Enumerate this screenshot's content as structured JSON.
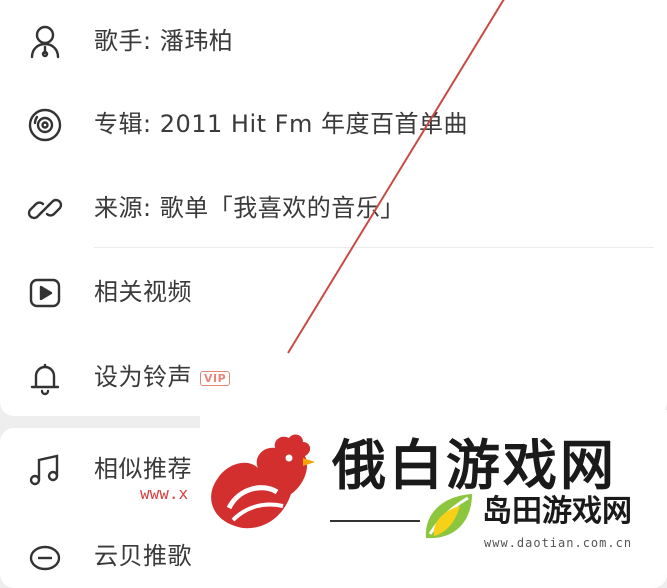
{
  "menu": {
    "items": [
      {
        "label": "歌手: 潘玮柏",
        "icon": "singer-icon"
      },
      {
        "label": "专辑: 2011 Hit Fm 年度百首单曲",
        "icon": "album-disc-icon"
      },
      {
        "label": "来源: 歌单「我喜欢的音乐」",
        "icon": "link-icon"
      },
      {
        "label": "相关视频",
        "icon": "video-play-icon"
      },
      {
        "label": "设为铃声",
        "icon": "bell-icon",
        "badge": "VIP"
      }
    ],
    "more_items": [
      {
        "label": "相似推荐",
        "icon": "music-notes-icon"
      },
      {
        "label": "云贝推歌",
        "icon": "cloud-shell-icon"
      }
    ]
  },
  "watermark": {
    "brand": "俄白游戏网",
    "brand_secondary": "岛田游戏网",
    "url": "www.daotian.com.cn",
    "url_partial": "www.x"
  },
  "colors": {
    "background": "#eeeeee",
    "card": "#ffffff",
    "text": "#3a3a3a",
    "vip": "#e8857a",
    "strike": "#c84a45",
    "rooster": "#d32f2f"
  }
}
